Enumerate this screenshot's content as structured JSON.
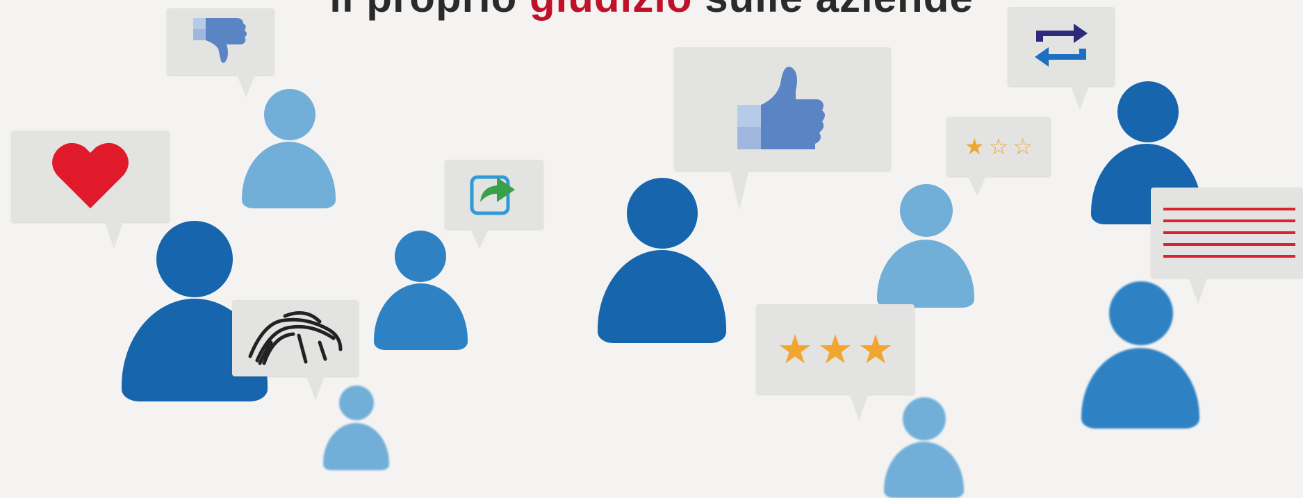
{
  "title": {
    "before": "il proprio ",
    "highlight": "giudizio",
    "after": " sulle aziende"
  },
  "colors": {
    "dark_blue": "#1765ad",
    "mid_blue": "#2e82c4",
    "light_blue": "#72afd8",
    "bubble": "#e3e3e2",
    "heart": "#e01a2b",
    "star": "#f2a632",
    "highlight": "#c0112b"
  },
  "icons": [
    "thumbs-down-icon",
    "heart-icon",
    "share-icon",
    "scribble-icon",
    "thumbs-up-icon",
    "one-star-rating-icon",
    "three-star-rating-icon",
    "retweet-icon",
    "text-lines-icon"
  ]
}
